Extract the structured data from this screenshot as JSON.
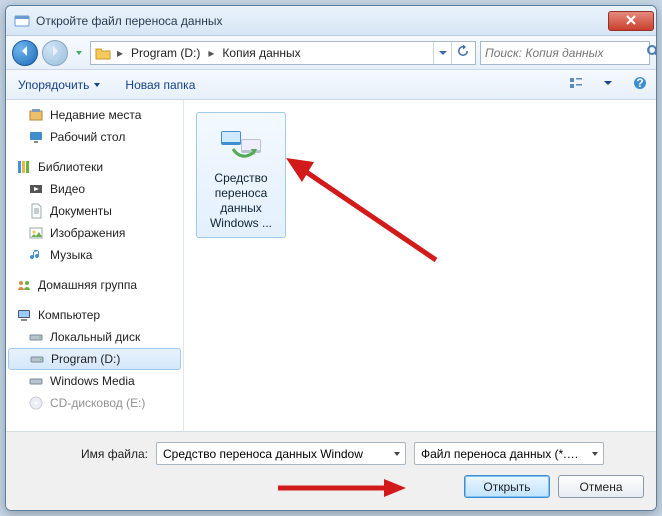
{
  "title": "Откройте файл переноса данных",
  "breadcrumb": {
    "seg1": "Program (D:)",
    "seg2": "Копия данных"
  },
  "search": {
    "placeholder": "Поиск: Копия данных"
  },
  "toolbar": {
    "organize": "Упорядочить",
    "newfolder": "Новая папка"
  },
  "sidebar": {
    "recent": "Недавние места",
    "desktop": "Рабочий стол",
    "libraries": "Библиотеки",
    "videos": "Видео",
    "documents": "Документы",
    "pictures": "Изображения",
    "music": "Музыка",
    "homegroup": "Домашняя группа",
    "computer": "Компьютер",
    "localdisk": "Локальный диск",
    "programd": "Program (D:)",
    "winmedia": "Windows Media",
    "cdrom": "CD-дисковод (E:)"
  },
  "file": {
    "label": "Средство переноса данных Windows ..."
  },
  "bottom": {
    "filename_label": "Имя файла:",
    "filename_value": "Средство переноса данных Window",
    "filter": "Файл переноса данных (*.MIG",
    "open": "Открыть",
    "cancel": "Отмена"
  }
}
